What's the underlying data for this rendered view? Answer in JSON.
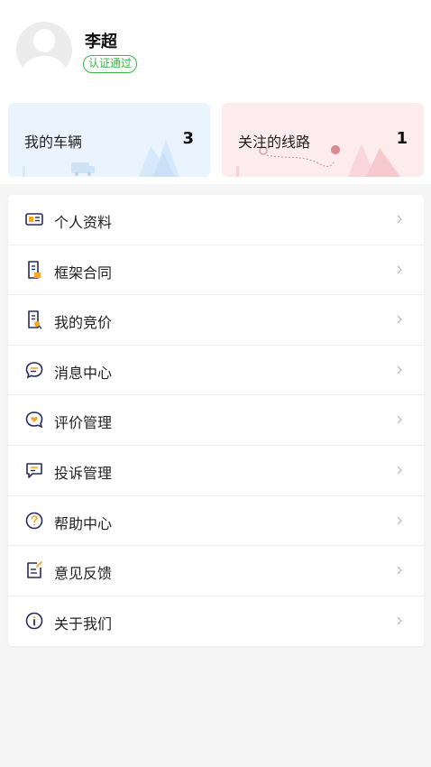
{
  "profile": {
    "name": "李超",
    "badge": "认证通过"
  },
  "cards": {
    "vehicles": {
      "label": "我的车辆",
      "count": "3"
    },
    "routes": {
      "label": "关注的线路",
      "count": "1"
    }
  },
  "menu": [
    {
      "label": "个人资料",
      "icon": "id-card-icon"
    },
    {
      "label": "框架合同",
      "icon": "contract-icon"
    },
    {
      "label": "我的竞价",
      "icon": "bid-document-icon"
    },
    {
      "label": "消息中心",
      "icon": "message-bubble-icon"
    },
    {
      "label": "评价管理",
      "icon": "review-heart-icon"
    },
    {
      "label": "投诉管理",
      "icon": "complaint-icon"
    },
    {
      "label": "帮助中心",
      "icon": "help-question-icon"
    },
    {
      "label": "意见反馈",
      "icon": "feedback-edit-icon"
    },
    {
      "label": "关于我们",
      "icon": "info-icon"
    }
  ],
  "colors": {
    "accent": "#2b2b5c",
    "badge_green": "#3bb44a",
    "icon_orange": "#f5a623",
    "vehicle_card_bg": "#eaf4ff",
    "route_card_bg": "#fdecee"
  }
}
